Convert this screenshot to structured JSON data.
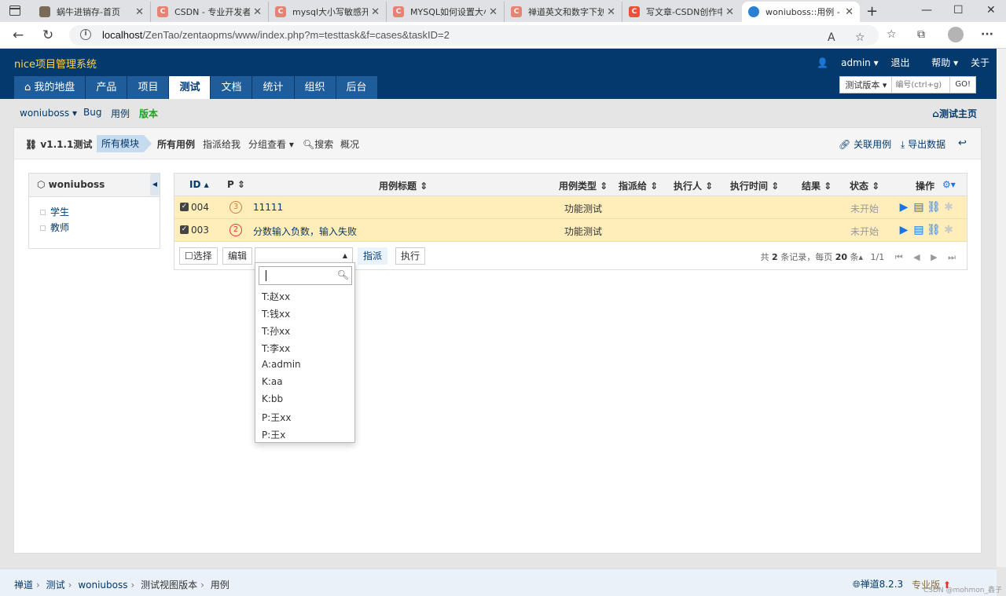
{
  "browser": {
    "tabs": [
      {
        "title": "蜗牛进销存-首页",
        "favicon_color": "#7a6a58"
      },
      {
        "title": "CSDN - 专业开发者",
        "favicon_color": "#e88374"
      },
      {
        "title": "mysql大小写敏感开",
        "favicon_color": "#e88374"
      },
      {
        "title": "MYSQL如何设置大小",
        "favicon_color": "#e88374"
      },
      {
        "title": "禅道英文和数字下划",
        "favicon_color": "#e88374"
      },
      {
        "title": "写文章-CSDN创作中",
        "favicon_color": "#e8513b"
      },
      {
        "title": "woniuboss::用例 - 禅",
        "favicon_color": "#2a7fd4"
      }
    ],
    "url_host": "localhost",
    "url_path": "/ZenTao/zentaopms/www/index.php?m=testtask&f=cases&taskID=2"
  },
  "header": {
    "brand": "nice项目管理系统",
    "user": "admin",
    "logout": "退出",
    "help": "帮助",
    "about": "关于",
    "nav": [
      "我的地盘",
      "产品",
      "项目",
      "测试",
      "文档",
      "统计",
      "组织",
      "后台"
    ],
    "search_scope": "测试版本",
    "search_placeholder": "编号(ctrl+g)",
    "go": "GO!"
  },
  "subnav": {
    "product": "woniuboss",
    "items": [
      "Bug",
      "用例",
      "版本"
    ],
    "home": "测试主页"
  },
  "featurebar": {
    "title": "v1.1.1测试",
    "module": "所有模块",
    "items": [
      "所有用例",
      "指派给我",
      "分组查看",
      "搜索",
      "概况"
    ],
    "link_cases": "关联用例",
    "export": "导出数据"
  },
  "side": {
    "title": "woniuboss",
    "modules": [
      "学生",
      "教师"
    ]
  },
  "table": {
    "headers": {
      "id": "ID",
      "p": "P",
      "title": "用例标题",
      "type": "用例类型",
      "assigned": "指派给",
      "runner": "执行人",
      "run_time": "执行时间",
      "result": "结果",
      "status": "状态",
      "actions": "操作"
    },
    "rows": [
      {
        "id": "004",
        "pri": "3",
        "title": "11111",
        "type": "功能测试",
        "status": "未开始"
      },
      {
        "id": "003",
        "pri": "2",
        "title": "分数输入负数，输入失败",
        "type": "功能测试",
        "status": "未开始"
      }
    ],
    "footer": {
      "select": "选择",
      "edit": "编辑",
      "assign": "指派",
      "run": "执行"
    },
    "pager": {
      "prefix": "共",
      "total": "2",
      "mid": "条记录，每页",
      "per_page": "20",
      "suffix": "条",
      "pages": "1/1"
    }
  },
  "dropdown": {
    "options": [
      "T:赵xx",
      "T:钱xx",
      "T:孙xx",
      "T:李xx",
      "A:admin",
      "K:aa",
      "K:bb",
      "P:王xx",
      "P:王x"
    ]
  },
  "statusbar": {
    "crumbs": [
      "禅道",
      "测试",
      "woniuboss",
      "测试视图版本",
      "用例"
    ],
    "version": "禅道8.2.3",
    "edition": "专业版"
  },
  "watermark": "CSDN @mohmon_鑫子"
}
